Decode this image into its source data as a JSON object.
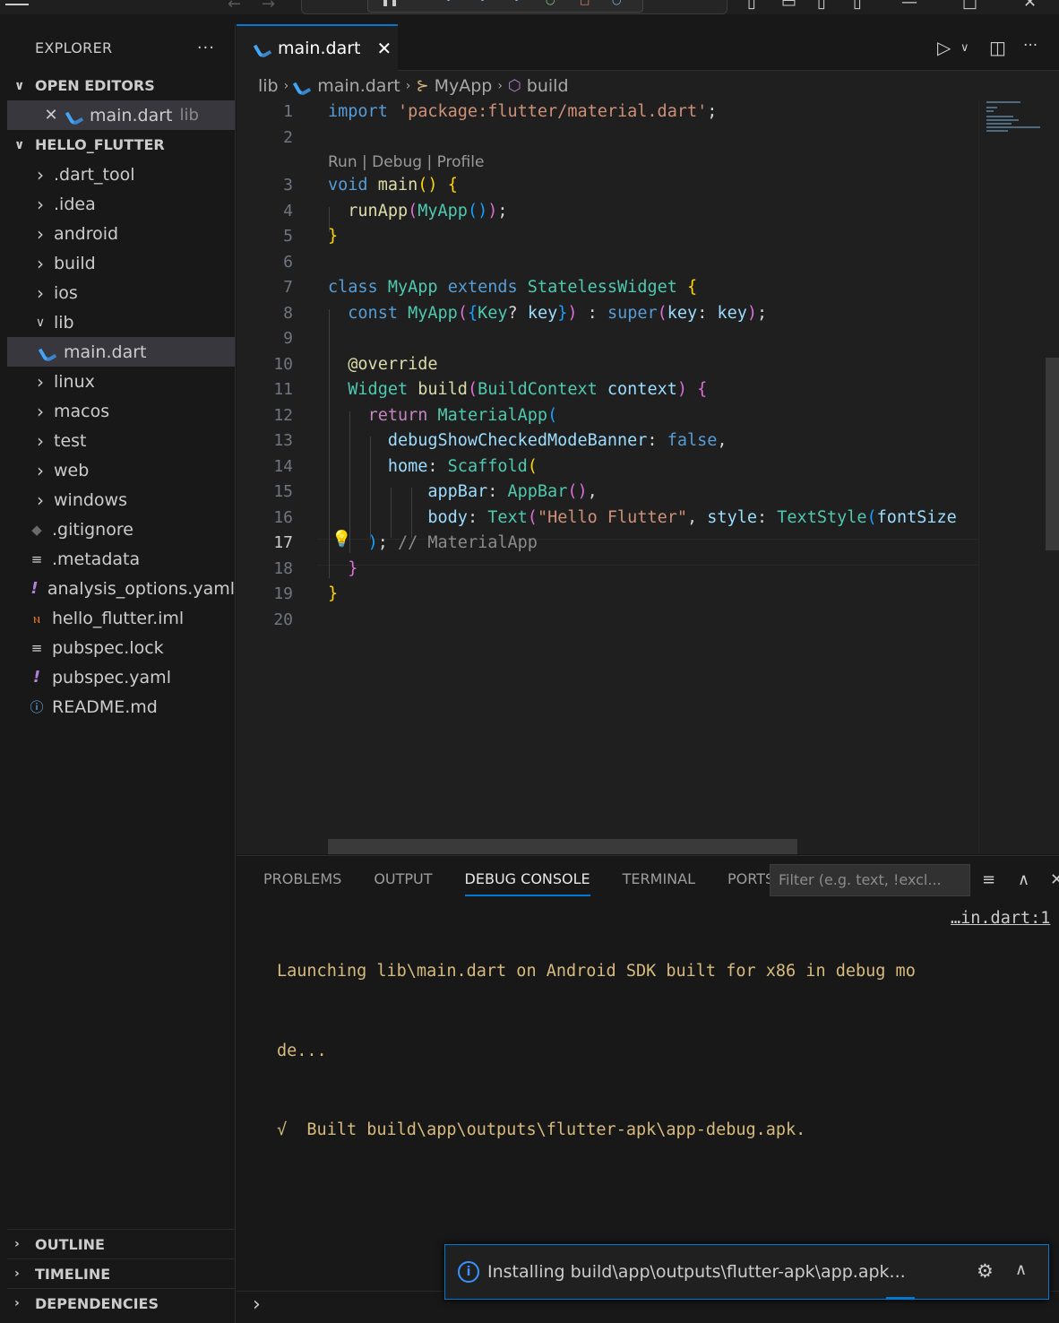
{
  "explorer": {
    "title": "EXPLORER",
    "more": "···",
    "open_editors": "OPEN EDITORS",
    "open_editor_item": {
      "name": "main.dart",
      "dir": "lib"
    },
    "project": "HELLO_FLUTTER",
    "tree": [
      {
        "label": ".dart_tool",
        "kind": "folder"
      },
      {
        "label": ".idea",
        "kind": "folder"
      },
      {
        "label": "android",
        "kind": "folder"
      },
      {
        "label": "build",
        "kind": "folder"
      },
      {
        "label": "ios",
        "kind": "folder"
      },
      {
        "label": "lib",
        "kind": "folder-open"
      },
      {
        "label": "main.dart",
        "kind": "dart"
      },
      {
        "label": "linux",
        "kind": "folder"
      },
      {
        "label": "macos",
        "kind": "folder"
      },
      {
        "label": "test",
        "kind": "folder"
      },
      {
        "label": "web",
        "kind": "folder"
      },
      {
        "label": "windows",
        "kind": "folder"
      },
      {
        "label": ".gitignore",
        "kind": "git"
      },
      {
        "label": ".metadata",
        "kind": "lines"
      },
      {
        "label": "analysis_options.yaml",
        "kind": "yaml"
      },
      {
        "label": "hello_flutter.iml",
        "kind": "rss"
      },
      {
        "label": "pubspec.lock",
        "kind": "lines"
      },
      {
        "label": "pubspec.yaml",
        "kind": "yaml"
      },
      {
        "label": "README.md",
        "kind": "info"
      }
    ],
    "bottom_sections": [
      "OUTLINE",
      "TIMELINE",
      "DEPENDENCIES"
    ]
  },
  "tab": {
    "label": "main.dart",
    "close": "✕"
  },
  "breadcrumb": {
    "folder": "lib",
    "file": "main.dart",
    "class": "MyApp",
    "method": "build"
  },
  "editor": {
    "codelens": "Run | Debug | Profile",
    "line_numbers": [
      "1",
      "2",
      "3",
      "4",
      "5",
      "6",
      "7",
      "8",
      "9",
      "10",
      "11",
      "12",
      "13",
      "14",
      "15",
      "16",
      "17",
      "18",
      "19",
      "20"
    ],
    "current_line": "17"
  },
  "panel": {
    "tabs": [
      "PROBLEMS",
      "OUTPUT",
      "DEBUG CONSOLE",
      "TERMINAL",
      "PORTS"
    ],
    "active_tab": "DEBUG CONSOLE",
    "filter_placeholder": "Filter (e.g. text, !excl...",
    "console_lines": [
      "Launching lib\\main.dart on Android SDK built for x86 in debug mo",
      "de...",
      "√  Built build\\app\\outputs\\flutter-apk\\app-debug.apk."
    ],
    "console_link": "…in.dart:1"
  },
  "notification": {
    "message": "Installing build\\app\\outputs\\flutter-apk\\app.apk..."
  },
  "icons": {
    "accent": "#0078d4",
    "dart": "dart-icon",
    "settings": "gear-icon"
  }
}
